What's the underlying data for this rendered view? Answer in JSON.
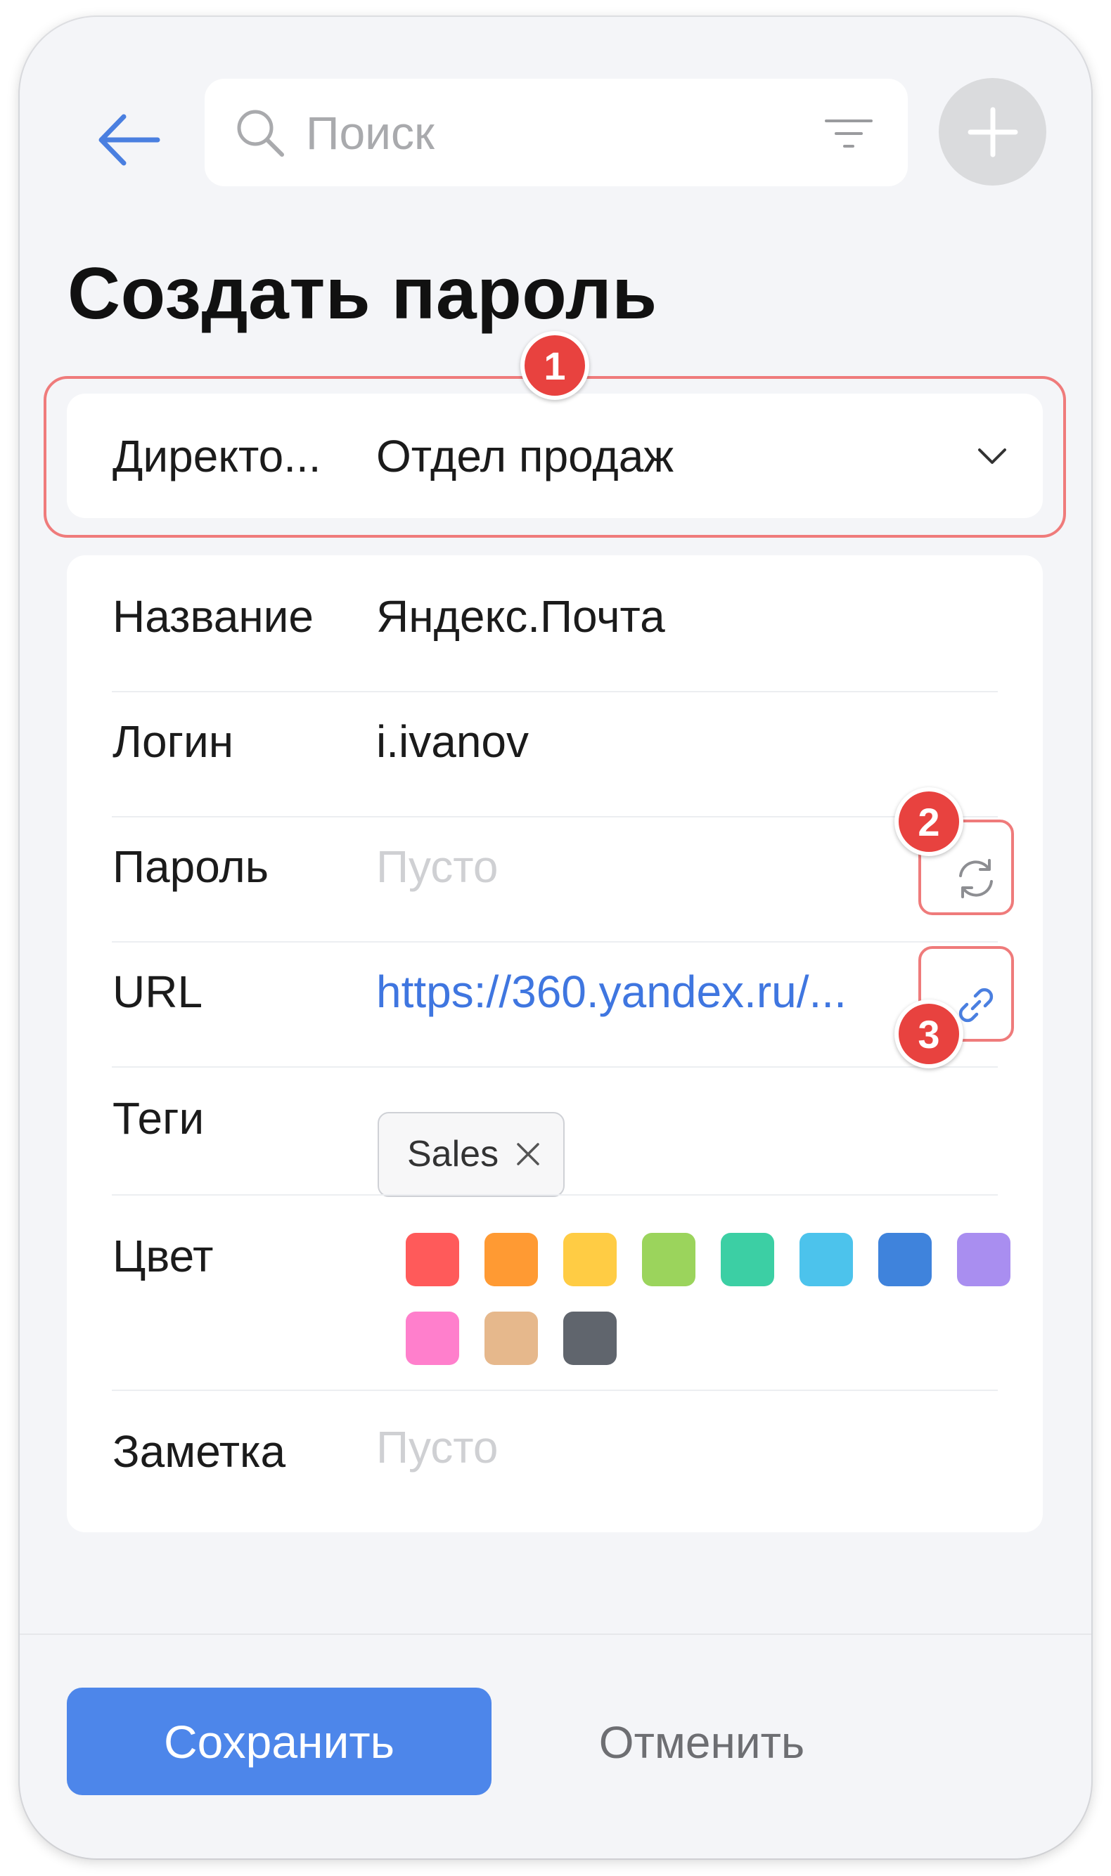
{
  "header": {
    "back_icon": "arrow-left-icon",
    "search": {
      "placeholder": "Поиск",
      "value": ""
    },
    "filter_icon": "filter-icon",
    "add_icon": "plus-icon"
  },
  "page": {
    "title": "Создать пароль"
  },
  "annotations": {
    "badge1": "1",
    "badge2": "2",
    "badge3": "3"
  },
  "directory": {
    "label": "Директо...",
    "value": "Отдел продаж",
    "chevron_icon": "chevron-down-icon"
  },
  "form": {
    "name": {
      "label": "Название",
      "value": "Яндекс.Почта"
    },
    "login": {
      "label": "Логин",
      "value": "i.ivanov"
    },
    "password": {
      "label": "Пароль",
      "placeholder": "Пусто",
      "action_icon": "refresh-icon"
    },
    "url": {
      "label": "URL",
      "value": "https://360.yandex.ru/...",
      "action_icon": "link-icon"
    },
    "tags": {
      "label": "Теги",
      "items": [
        {
          "text": "Sales"
        }
      ]
    },
    "color": {
      "label": "Цвет",
      "swatches": [
        "#ff5a5a",
        "#ff9a33",
        "#ffcc44",
        "#9bd45c",
        "#3ccfa4",
        "#4cc3ec",
        "#3f83dc",
        "#a98ef0",
        "#ff7fcc",
        "#e6b88c",
        "#60656d"
      ]
    },
    "note": {
      "label": "Заметка",
      "placeholder": "Пусто"
    }
  },
  "footer": {
    "save_label": "Сохранить",
    "cancel_label": "Отменить"
  },
  "colors": {
    "accent": "#4d86ea",
    "annotation": "#e8423f",
    "link": "#3f76e0"
  }
}
